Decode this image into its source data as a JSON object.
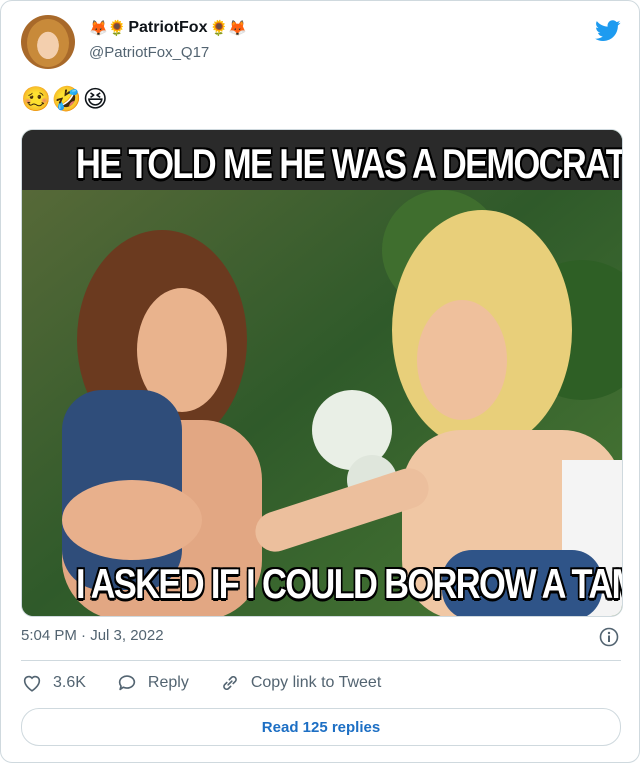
{
  "tweet": {
    "author": {
      "display_name": "PatriotFox",
      "name_emojis_before": "🦊🌻",
      "name_emojis_after": "🌻🦊",
      "handle": "@PatriotFox_Q17"
    },
    "text_emojis": "🥴🤣😆",
    "media": {
      "top_caption": "HE TOLD ME HE WAS A DEMOCRAT",
      "bottom_caption": "I ASKED IF I COULD BORROW A TAMPON"
    },
    "timestamp": "5:04 PM · Jul 3, 2022",
    "actions": {
      "likes": "3.6K",
      "reply_label": "Reply",
      "copy_link_label": "Copy link to Tweet"
    },
    "read_replies_label": "Read 125 replies"
  },
  "colors": {
    "twitter_blue": "#1d9bf0",
    "link_blue": "#1d6fc4",
    "secondary_text": "#536471",
    "border": "#cfd9de"
  },
  "icons": {
    "logo": "twitter-bird-icon",
    "like": "heart-icon",
    "reply": "speech-bubble-icon",
    "copy": "link-icon",
    "info": "info-icon"
  }
}
